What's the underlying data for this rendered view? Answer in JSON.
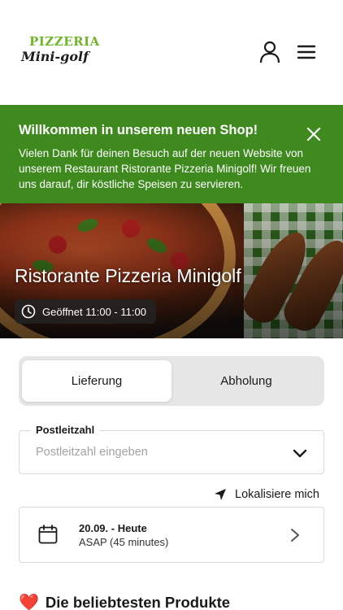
{
  "header": {
    "logo_line1": "PIZZERIA",
    "logo_line2": "Mini-golf",
    "icons": [
      "user-icon",
      "hamburger-menu-icon"
    ]
  },
  "banner": {
    "title": "Willkommen in unserem neuen Shop!",
    "text": "Vielen Dank für deinen Besuch auf der neuen Website von unserem Restaurant Ristorante Pizzeria Minigolf! Wir freuen uns darauf, dir köstliche Speisen zu servieren.",
    "background_color": "#3e8a1f",
    "close_icon": "close-icon"
  },
  "hero": {
    "title": "Ristorante Pizzeria Minigolf",
    "hours": "Geöffnet 11:00 - 11:00",
    "hours_icon": "clock-icon"
  },
  "order_mode": {
    "options": [
      "Lieferung",
      "Abholung"
    ],
    "selected": "Lieferung"
  },
  "postcode": {
    "label": "Postleitzahl",
    "placeholder": "Postleitzahl eingeben",
    "value": "",
    "icon": "chevron-down-icon"
  },
  "locate": {
    "label": "Lokalisiere mich",
    "icon": "location-arrow-icon"
  },
  "delivery_time": {
    "date": "20.09. - Heute",
    "time": "ASAP (45 minutes)",
    "icon": "calendar-icon",
    "chevron_icon": "chevron-right-icon"
  },
  "popular": {
    "emoji": "❤️",
    "title": "Die beliebtesten Produkte"
  }
}
